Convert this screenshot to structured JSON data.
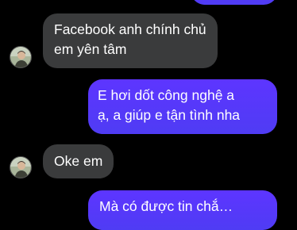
{
  "conversation": {
    "messages": [
      {
        "side": "outgoing",
        "text": ""
      },
      {
        "side": "incoming",
        "line1": "Facebook anh chính chủ",
        "line2": "em yên tâm"
      },
      {
        "side": "outgoing",
        "line1": "E hơi dốt công nghệ a",
        "line2": "ạ, a giúp e tận tình nha"
      },
      {
        "side": "incoming",
        "text": "Oke em"
      },
      {
        "side": "outgoing",
        "text": "Mà có được tin chắ…"
      }
    ]
  },
  "colors": {
    "background": "#000000",
    "incoming_bubble": "#3a3b3c",
    "outgoing_bubble": "#5a37fb",
    "text": "#ffffff"
  },
  "icons": {
    "avatar": "contact-avatar"
  }
}
